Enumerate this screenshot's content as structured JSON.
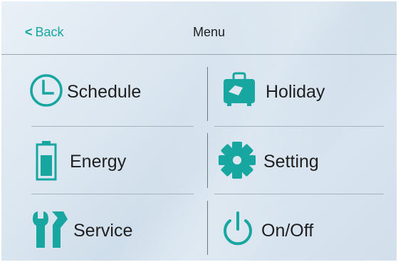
{
  "header": {
    "back_label": "Back",
    "back_glyph": "<",
    "title": "Menu"
  },
  "menu": {
    "schedule": "Schedule",
    "holiday": "Holiday",
    "energy": "Energy",
    "setting": "Setting",
    "service": "Service",
    "onoff": "On/Off"
  },
  "colors": {
    "accent": "#17a7a0",
    "text": "#1f1f1f"
  },
  "icons": [
    "clock-icon",
    "suitcase-icon",
    "battery-icon",
    "gear-icon",
    "wrench-icon",
    "power-icon"
  ]
}
